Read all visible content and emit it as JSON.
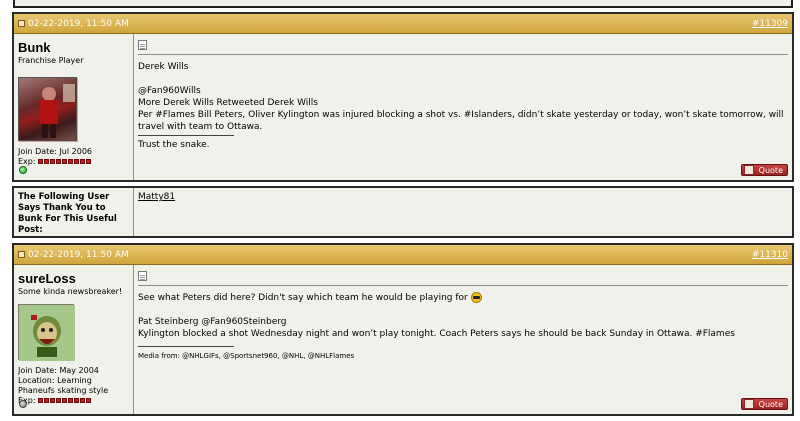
{
  "posts": [
    {
      "date": "02-22-2019, 11:50 AM",
      "number": "#11309",
      "username": "Bunk",
      "usertitle": "Franchise Player",
      "join_date": "Join Date: Jul 2006",
      "location": "",
      "exp_label": "Exp:",
      "lines": [
        "Derek Wills",
        "@Fan960Wills",
        "More Derek Wills Retweeted Derek Wills",
        "Per #Flames Bill Peters, Oliver Kylington was injured blocking a shot vs. #Islanders, didn’t skate yesterday or today, won’t skate tomorrow, will travel with team to Ottawa.",
        "Trust the snake."
      ],
      "quote_label": "Quote",
      "status": "online",
      "status_color": "#22aa22"
    },
    {
      "date": "02-22-2019, 11:50 AM",
      "number": "#11310",
      "username": "sureLoss",
      "usertitle": "Some kinda newsbreaker!",
      "join_date": "Join Date: May 2004",
      "location": "Location: Learning Phaneufs skating style",
      "exp_label": "Exp:",
      "lines": [
        "See what Peters did here? Didn't say which team he would be playing for",
        "Pat Steinberg @Fan960Steinberg",
        "Kylington blocked a shot Wednesday night and won’t play tonight. Coach Peters says he should be back Sunday in Ottawa. #Flames",
        "Media from: @NHLGIFs, @Sportsnet960, @NHL, @NHLFlames"
      ],
      "quote_label": "Quote",
      "status": "offline",
      "status_color": "#777777"
    }
  ],
  "thanks": {
    "label": "The Following User Says Thank You to Bunk For This Useful Post:",
    "users": [
      "Matty81"
    ]
  },
  "colors": {
    "header_gold": "#cfa53b",
    "post_bg": "#f1f1ec",
    "rep_red": "#c81a1a",
    "quote_red": "#922222"
  }
}
